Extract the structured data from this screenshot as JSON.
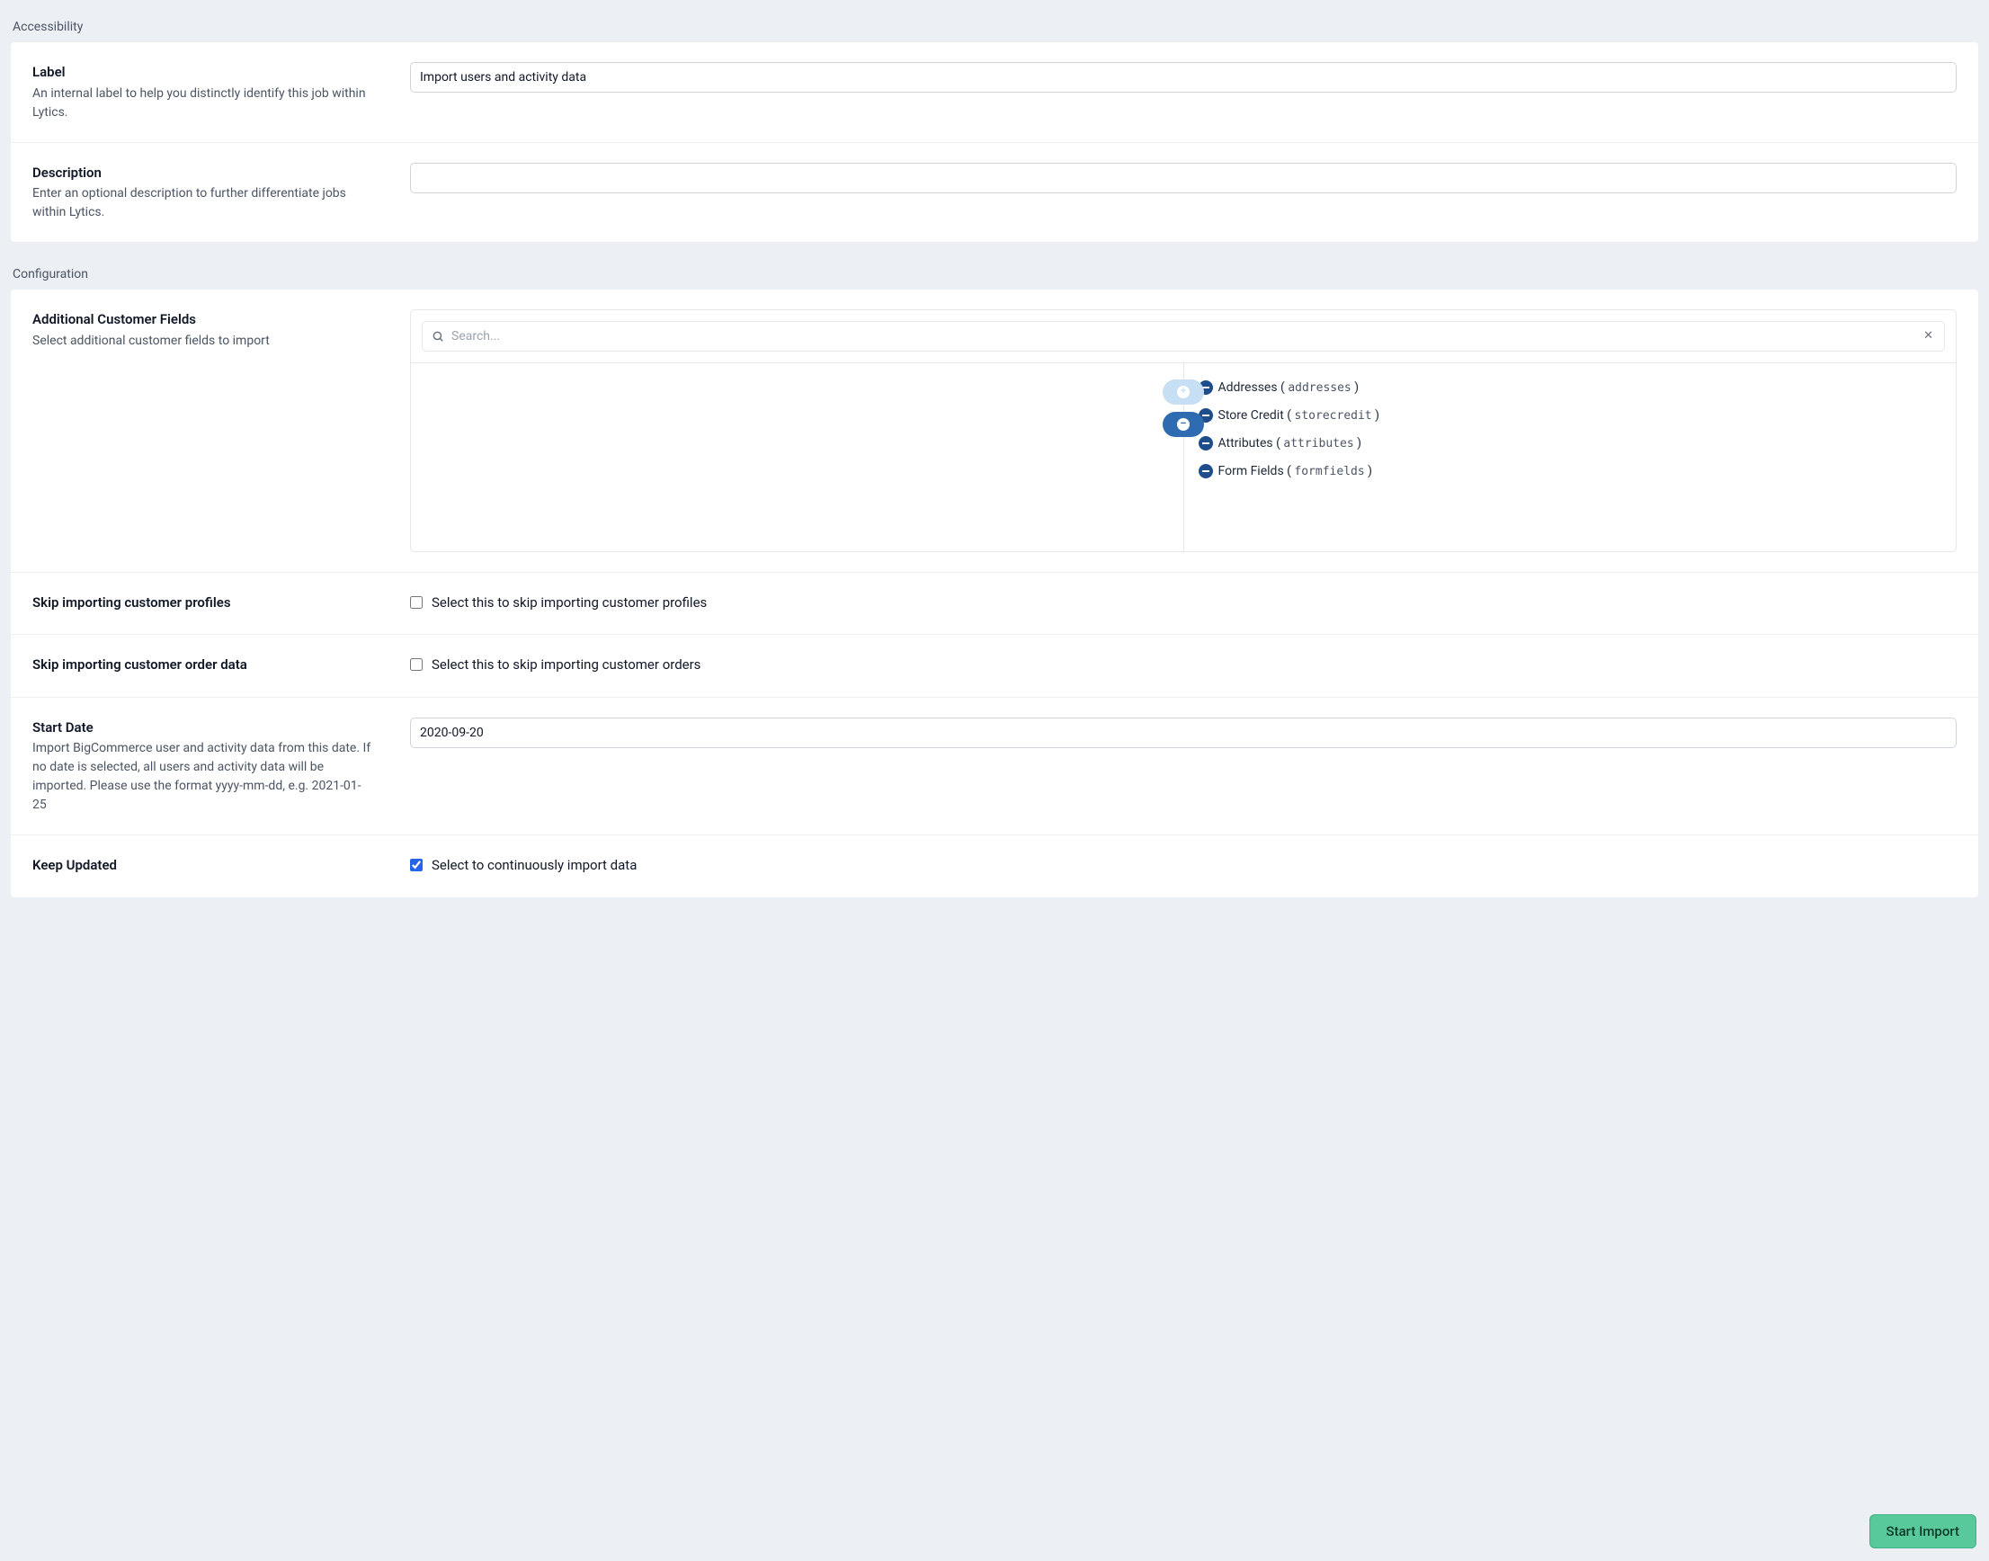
{
  "sections": {
    "accessibility": "Accessibility",
    "configuration": "Configuration"
  },
  "accessibility": {
    "label": {
      "title": "Label",
      "help": "An internal label to help you distinctly identify this job within Lytics.",
      "value": "Import users and activity data"
    },
    "description": {
      "title": "Description",
      "help": "Enter an optional description to further differentiate jobs within Lytics.",
      "value": ""
    }
  },
  "configuration": {
    "additionalFields": {
      "title": "Additional Customer Fields",
      "help": "Select additional customer fields to import",
      "searchPlaceholder": "Search...",
      "selected": [
        {
          "label": "Addresses",
          "code": "addresses"
        },
        {
          "label": "Store Credit",
          "code": "storecredit"
        },
        {
          "label": "Attributes",
          "code": "attributes"
        },
        {
          "label": "Form Fields",
          "code": "formfields"
        }
      ]
    },
    "skipProfiles": {
      "title": "Skip importing customer profiles",
      "checkboxLabel": "Select this to skip importing customer profiles",
      "checked": false
    },
    "skipOrders": {
      "title": "Skip importing customer order data",
      "checkboxLabel": "Select this to skip importing customer orders",
      "checked": false
    },
    "startDate": {
      "title": "Start Date",
      "help": "Import BigCommerce user and activity data from this date. If no date is selected, all users and activity data will be imported. Please use the format yyyy-mm-dd, e.g. 2021-01-25",
      "value": "2020-09-20"
    },
    "keepUpdated": {
      "title": "Keep Updated",
      "checkboxLabel": "Select to continuously import data",
      "checked": true
    }
  },
  "footer": {
    "submitLabel": "Start Import"
  }
}
